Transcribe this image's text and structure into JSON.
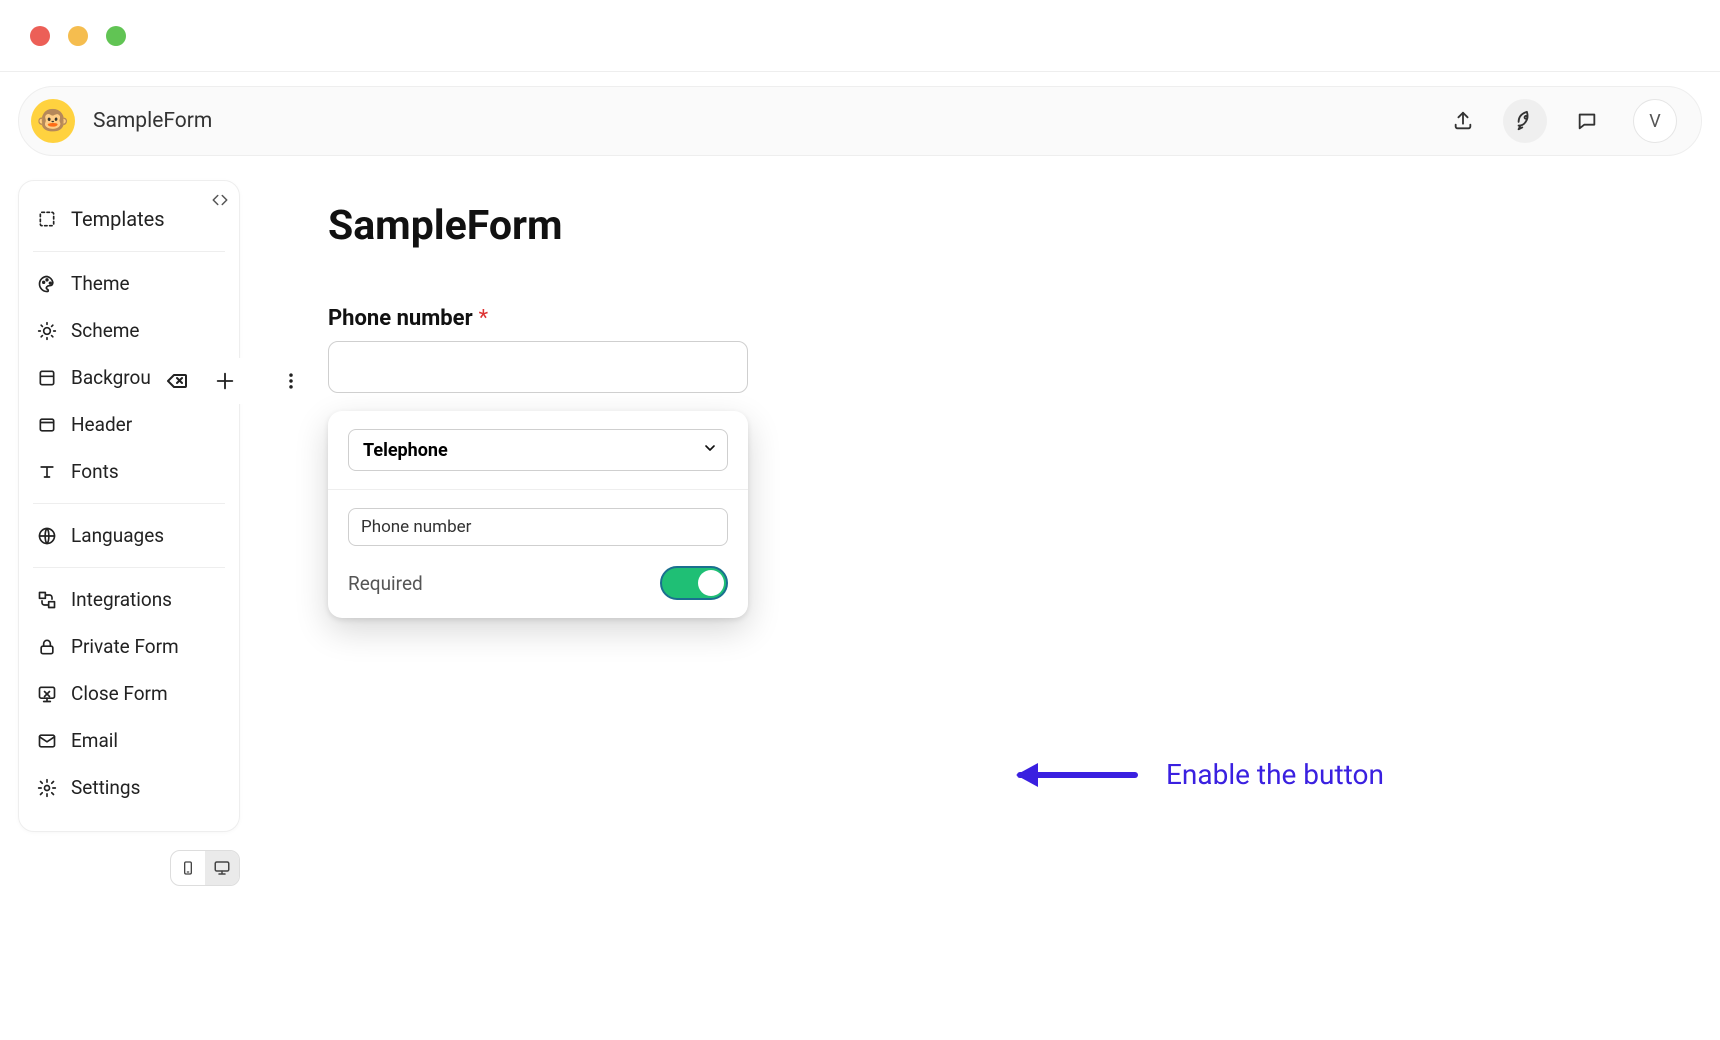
{
  "header": {
    "form_name": "SampleForm",
    "avatar_initial": "V"
  },
  "sidebar": {
    "items": [
      "Templates",
      "Theme",
      "Scheme",
      "Background",
      "Header",
      "Fonts",
      "Languages",
      "Integrations",
      "Private Form",
      "Close Form",
      "Email",
      "Settings"
    ]
  },
  "main": {
    "title": "SampleForm",
    "field_label": "Phone number",
    "required_mark": "*"
  },
  "popover": {
    "type_selected": "Telephone",
    "field_name_value": "Phone number",
    "required_label": "Required",
    "required_on": true
  },
  "annotation": {
    "text": "Enable the button"
  }
}
